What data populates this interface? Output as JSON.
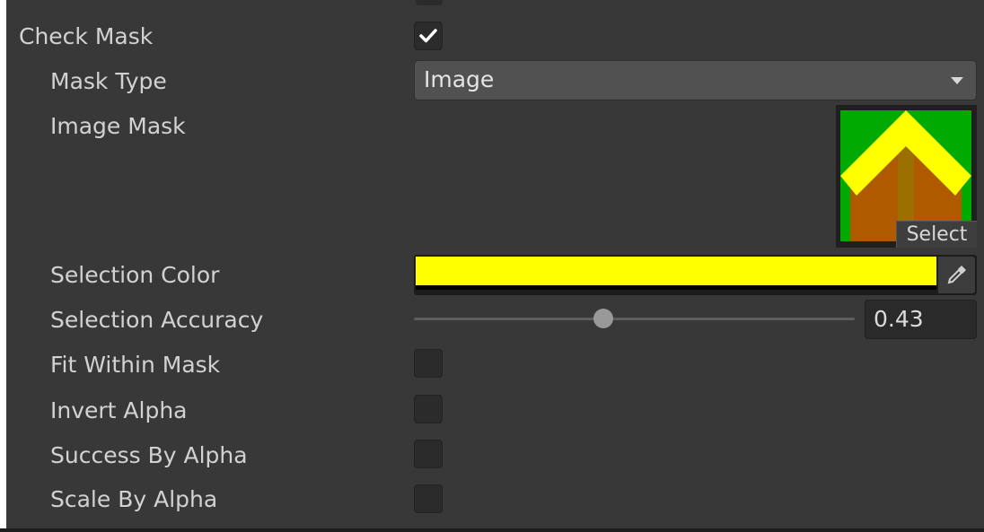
{
  "inspector": {
    "check_mask": {
      "label": "Check Mask",
      "checked": true
    },
    "mask_type": {
      "label": "Mask Type",
      "value": "Image"
    },
    "image_mask": {
      "label": "Image Mask",
      "select_label": "Select"
    },
    "selection_color": {
      "label": "Selection Color",
      "color": "#ffff00"
    },
    "selection_accuracy": {
      "label": "Selection Accuracy",
      "value": "0.43",
      "fraction": 0.43
    },
    "fit_within_mask": {
      "label": "Fit Within Mask",
      "checked": false
    },
    "invert_alpha": {
      "label": "Invert Alpha",
      "checked": false
    },
    "success_by_alpha": {
      "label": "Success By Alpha",
      "checked": false
    },
    "scale_by_alpha": {
      "label": "Scale By Alpha",
      "checked": false
    }
  },
  "icons": {
    "checkmark": "checkmark-icon",
    "dropdown": "triangle-down-icon",
    "eyedropper": "eyedropper-icon"
  },
  "colors": {
    "panel_bg": "#383838",
    "label_text": "#d2d2d2",
    "mask_green": "#00aa00",
    "mask_yellow": "#ffff00",
    "mask_brown": "#b05a00"
  }
}
